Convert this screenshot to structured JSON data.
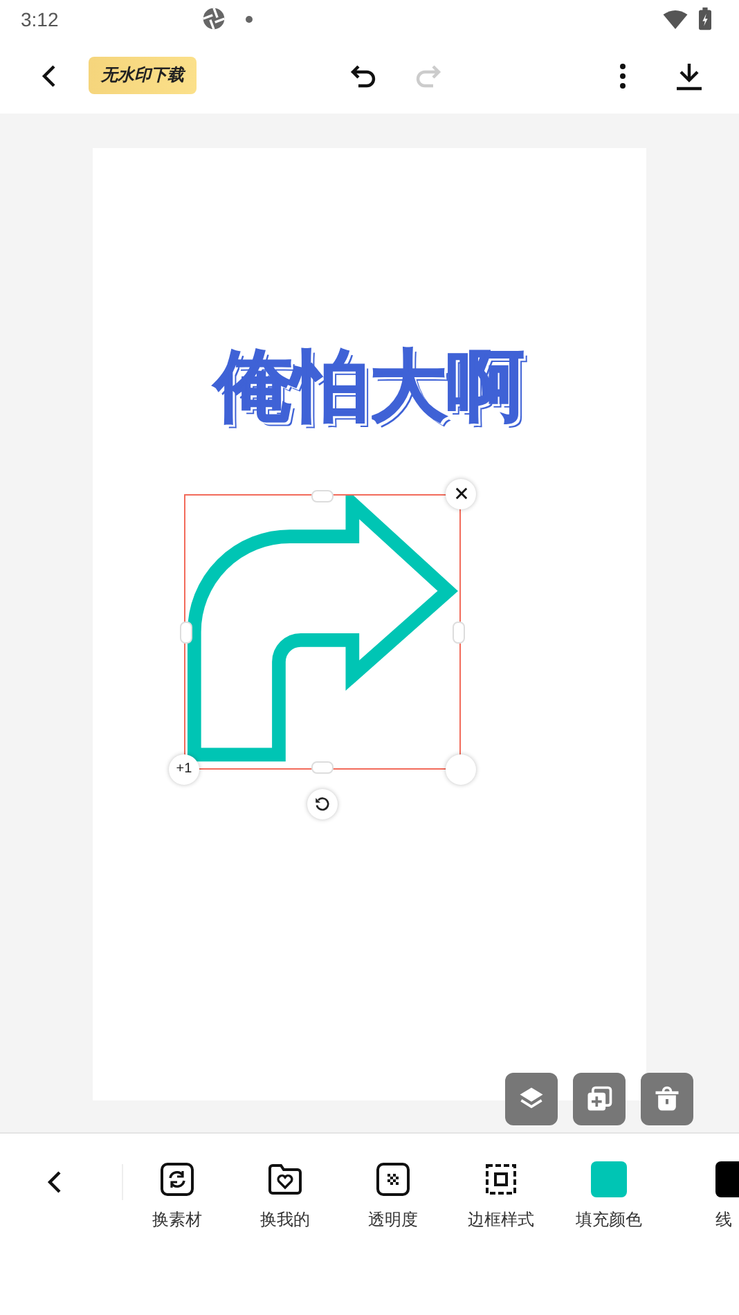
{
  "status_bar": {
    "time": "3:12"
  },
  "top_bar": {
    "badge": "无水印下载",
    "undo_disabled": false,
    "redo_disabled": true
  },
  "canvas": {
    "heading": "俺怕大啊",
    "selection": {
      "corner_badge": "+1"
    }
  },
  "toolbar": [
    {
      "kind": "icon",
      "label": "换素材"
    },
    {
      "kind": "icon",
      "label": "换我的"
    },
    {
      "kind": "icon",
      "label": "透明度"
    },
    {
      "kind": "icon",
      "label": "边框样式"
    },
    {
      "kind": "swatch",
      "color": "#00c5b4",
      "label": "填充颜色"
    },
    {
      "kind": "swatch",
      "color": "#000000",
      "label": "线"
    }
  ]
}
